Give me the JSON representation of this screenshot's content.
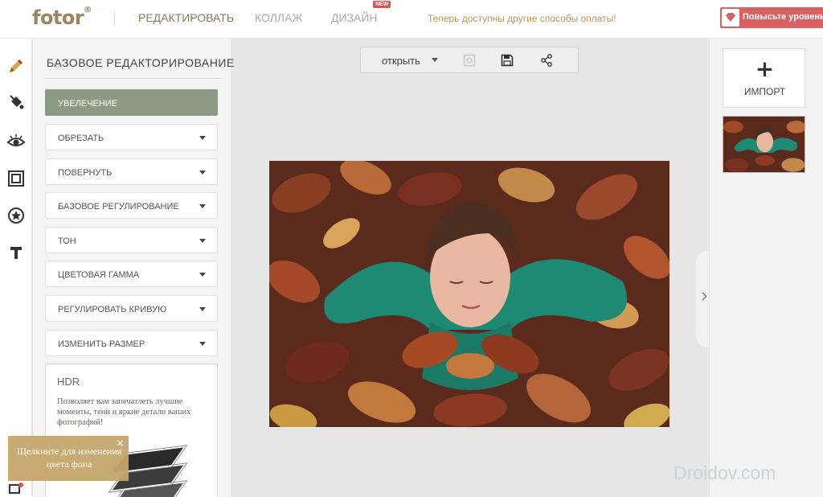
{
  "header": {
    "logo": "fotor",
    "logo_mark": "®",
    "nav": [
      {
        "label": "РЕДАКТИРОВАТЬ",
        "active": true
      },
      {
        "label": "КОЛЛАЖ",
        "active": false
      },
      {
        "label": "ДИЗАЙН",
        "active": false
      }
    ],
    "new_badge": "NEW",
    "promo": "Теперь доступны другие способы оплаты!",
    "upgrade_label": "Повысьте уровень"
  },
  "rail": {
    "icons": [
      "pencil-icon",
      "paint-bucket-icon",
      "eye-icon",
      "frame-icon",
      "sticker-star-icon",
      "text-icon"
    ]
  },
  "panel": {
    "title": "БАЗОВОЕ РЕДАКТОРИРОВАНИЕ",
    "items": [
      {
        "label": "УВЕЛЕЧЕНИЕ"
      },
      {
        "label": "ОБРЕЗАТЬ"
      },
      {
        "label": "ПОВЕРНУТЬ"
      },
      {
        "label": "БАЗОВОЕ РЕГУЛИРОВАНИЕ"
      },
      {
        "label": "ТОН"
      },
      {
        "label": "ЦВЕТОВАЯ ГАММА"
      },
      {
        "label": "РЕГУЛИРОВАТЬ КРИВУЮ"
      },
      {
        "label": "ИЗМЕНИТЬ РАЗМЕР"
      }
    ],
    "hdr": {
      "title": "HDR",
      "description": "Позволяет вам запечатлеть лучшие моменты, тени и яркие детали ваших фотографий!"
    }
  },
  "tooltip": {
    "text": "Щелкните для изменения цвета фона",
    "close": "×"
  },
  "toolbar": {
    "open_label": "открыть"
  },
  "right_panel": {
    "import_label": "ИМПОРТ",
    "import_plus": "+"
  },
  "watermark": "Droidov.com",
  "colors": {
    "brand": "#9a8560",
    "active_tool": "#8c9a84",
    "upgrade": "#d86161",
    "tooltip": "#c6a76b",
    "promo": "#b9975b"
  }
}
